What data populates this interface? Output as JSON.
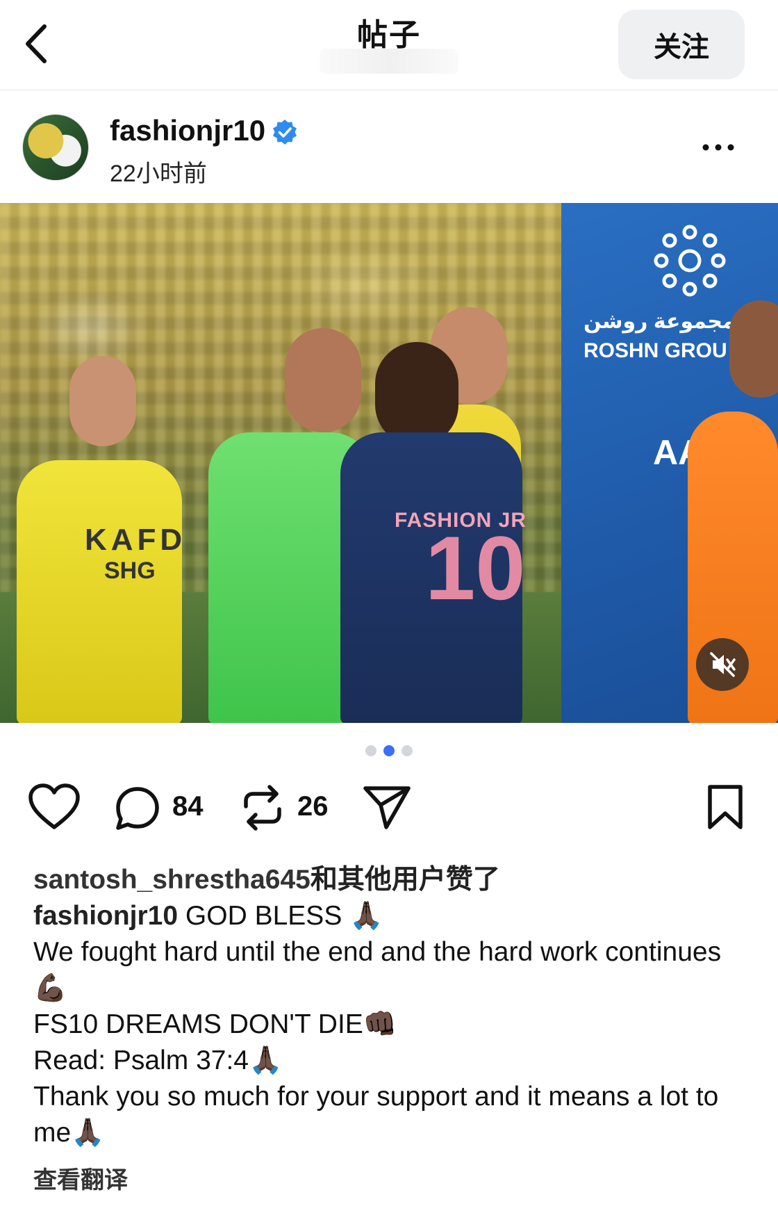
{
  "header": {
    "title": "帖子",
    "follow_label": "关注"
  },
  "author": {
    "username": "fashionjr10",
    "verified": true,
    "time_ago": "22小时前"
  },
  "media": {
    "banner_text": "مجموعة روشن\nROSHN GROU",
    "banner_mark": "AADE",
    "jersey_name": "FASHION JR",
    "jersey_number": "10",
    "shirt_sponsor_1": "KAFD",
    "shirt_sponsor_2": "SHG",
    "carousel_total": 3,
    "carousel_active_index": 1
  },
  "actions": {
    "comments_count": "84",
    "reposts_count": "26"
  },
  "likes_line": {
    "user": "santosh_shrestha645",
    "suffix": "和其他用户赞了"
  },
  "caption": {
    "user": "fashionjr10",
    "lines": [
      "GOD BLESS 🙏🏿",
      "We fought hard until the end and the hard work continues 💪🏿",
      "FS10 DREAMS DON'T DIE👊🏿",
      "Read: Psalm 37:4🙏🏿",
      "Thank you so much for your support and it means a lot to me🙏🏿"
    ]
  },
  "translate_label": "查看翻译",
  "colors": {
    "accent_dot": "#3d6dfb",
    "verified_blue": "#2e8bf0",
    "follow_bg": "#eff0f2"
  },
  "icons": [
    "back-chevron-icon",
    "verified-badge-icon",
    "more-options-icon",
    "mute-icon",
    "heart-icon",
    "comment-icon",
    "repost-icon",
    "share-icon",
    "bookmark-icon"
  ]
}
